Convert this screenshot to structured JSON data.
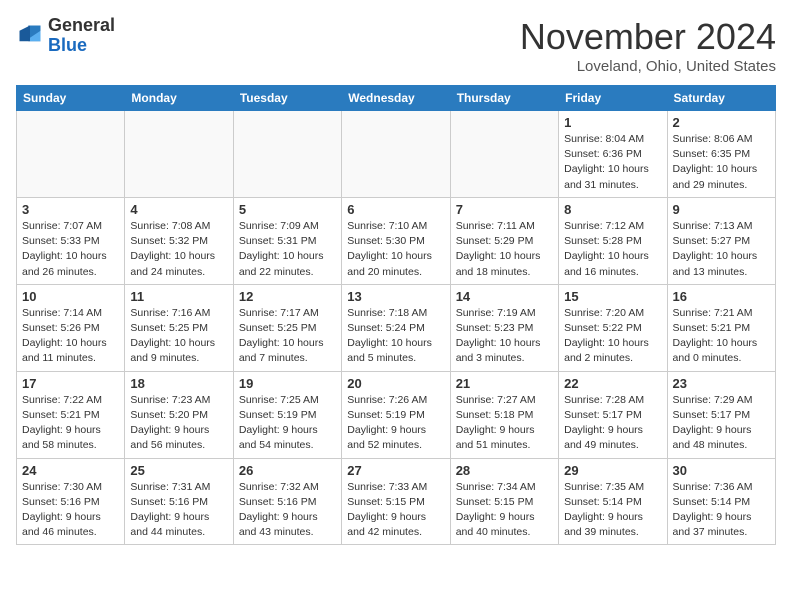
{
  "header": {
    "logo_line1": "General",
    "logo_line2": "Blue",
    "month": "November 2024",
    "location": "Loveland, Ohio, United States"
  },
  "days_of_week": [
    "Sunday",
    "Monday",
    "Tuesday",
    "Wednesday",
    "Thursday",
    "Friday",
    "Saturday"
  ],
  "weeks": [
    [
      {
        "num": "",
        "info": ""
      },
      {
        "num": "",
        "info": ""
      },
      {
        "num": "",
        "info": ""
      },
      {
        "num": "",
        "info": ""
      },
      {
        "num": "",
        "info": ""
      },
      {
        "num": "1",
        "info": "Sunrise: 8:04 AM\nSunset: 6:36 PM\nDaylight: 10 hours\nand 31 minutes."
      },
      {
        "num": "2",
        "info": "Sunrise: 8:06 AM\nSunset: 6:35 PM\nDaylight: 10 hours\nand 29 minutes."
      }
    ],
    [
      {
        "num": "3",
        "info": "Sunrise: 7:07 AM\nSunset: 5:33 PM\nDaylight: 10 hours\nand 26 minutes."
      },
      {
        "num": "4",
        "info": "Sunrise: 7:08 AM\nSunset: 5:32 PM\nDaylight: 10 hours\nand 24 minutes."
      },
      {
        "num": "5",
        "info": "Sunrise: 7:09 AM\nSunset: 5:31 PM\nDaylight: 10 hours\nand 22 minutes."
      },
      {
        "num": "6",
        "info": "Sunrise: 7:10 AM\nSunset: 5:30 PM\nDaylight: 10 hours\nand 20 minutes."
      },
      {
        "num": "7",
        "info": "Sunrise: 7:11 AM\nSunset: 5:29 PM\nDaylight: 10 hours\nand 18 minutes."
      },
      {
        "num": "8",
        "info": "Sunrise: 7:12 AM\nSunset: 5:28 PM\nDaylight: 10 hours\nand 16 minutes."
      },
      {
        "num": "9",
        "info": "Sunrise: 7:13 AM\nSunset: 5:27 PM\nDaylight: 10 hours\nand 13 minutes."
      }
    ],
    [
      {
        "num": "10",
        "info": "Sunrise: 7:14 AM\nSunset: 5:26 PM\nDaylight: 10 hours\nand 11 minutes."
      },
      {
        "num": "11",
        "info": "Sunrise: 7:16 AM\nSunset: 5:25 PM\nDaylight: 10 hours\nand 9 minutes."
      },
      {
        "num": "12",
        "info": "Sunrise: 7:17 AM\nSunset: 5:25 PM\nDaylight: 10 hours\nand 7 minutes."
      },
      {
        "num": "13",
        "info": "Sunrise: 7:18 AM\nSunset: 5:24 PM\nDaylight: 10 hours\nand 5 minutes."
      },
      {
        "num": "14",
        "info": "Sunrise: 7:19 AM\nSunset: 5:23 PM\nDaylight: 10 hours\nand 3 minutes."
      },
      {
        "num": "15",
        "info": "Sunrise: 7:20 AM\nSunset: 5:22 PM\nDaylight: 10 hours\nand 2 minutes."
      },
      {
        "num": "16",
        "info": "Sunrise: 7:21 AM\nSunset: 5:21 PM\nDaylight: 10 hours\nand 0 minutes."
      }
    ],
    [
      {
        "num": "17",
        "info": "Sunrise: 7:22 AM\nSunset: 5:21 PM\nDaylight: 9 hours\nand 58 minutes."
      },
      {
        "num": "18",
        "info": "Sunrise: 7:23 AM\nSunset: 5:20 PM\nDaylight: 9 hours\nand 56 minutes."
      },
      {
        "num": "19",
        "info": "Sunrise: 7:25 AM\nSunset: 5:19 PM\nDaylight: 9 hours\nand 54 minutes."
      },
      {
        "num": "20",
        "info": "Sunrise: 7:26 AM\nSunset: 5:19 PM\nDaylight: 9 hours\nand 52 minutes."
      },
      {
        "num": "21",
        "info": "Sunrise: 7:27 AM\nSunset: 5:18 PM\nDaylight: 9 hours\nand 51 minutes."
      },
      {
        "num": "22",
        "info": "Sunrise: 7:28 AM\nSunset: 5:17 PM\nDaylight: 9 hours\nand 49 minutes."
      },
      {
        "num": "23",
        "info": "Sunrise: 7:29 AM\nSunset: 5:17 PM\nDaylight: 9 hours\nand 48 minutes."
      }
    ],
    [
      {
        "num": "24",
        "info": "Sunrise: 7:30 AM\nSunset: 5:16 PM\nDaylight: 9 hours\nand 46 minutes."
      },
      {
        "num": "25",
        "info": "Sunrise: 7:31 AM\nSunset: 5:16 PM\nDaylight: 9 hours\nand 44 minutes."
      },
      {
        "num": "26",
        "info": "Sunrise: 7:32 AM\nSunset: 5:16 PM\nDaylight: 9 hours\nand 43 minutes."
      },
      {
        "num": "27",
        "info": "Sunrise: 7:33 AM\nSunset: 5:15 PM\nDaylight: 9 hours\nand 42 minutes."
      },
      {
        "num": "28",
        "info": "Sunrise: 7:34 AM\nSunset: 5:15 PM\nDaylight: 9 hours\nand 40 minutes."
      },
      {
        "num": "29",
        "info": "Sunrise: 7:35 AM\nSunset: 5:14 PM\nDaylight: 9 hours\nand 39 minutes."
      },
      {
        "num": "30",
        "info": "Sunrise: 7:36 AM\nSunset: 5:14 PM\nDaylight: 9 hours\nand 37 minutes."
      }
    ]
  ]
}
